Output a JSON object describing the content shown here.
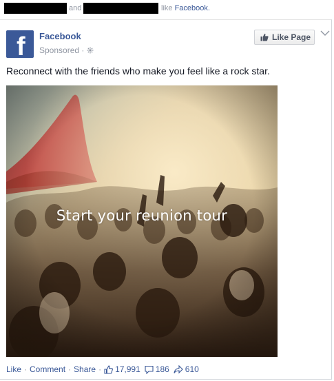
{
  "context": {
    "and_text": "and",
    "like_prefix": "like",
    "like_page": "Facebook."
  },
  "post": {
    "page_name": "Facebook",
    "sponsored": "Sponsored",
    "like_button": "Like Page",
    "text": "Reconnect with the friends who make you feel like a rock star.",
    "image_caption": "Start your reunion tour"
  },
  "footer": {
    "like": "Like",
    "comment": "Comment",
    "share": "Share",
    "likes_count": "17,991",
    "comments_count": "186",
    "shares_count": "610"
  },
  "colors": {
    "brand": "#3b5998",
    "meta": "#9197a3"
  },
  "icons": [
    "facebook-logo-icon",
    "globe-icon",
    "thumbs-up-icon",
    "chevron-down-icon",
    "comment-icon",
    "share-arrow-icon"
  ]
}
